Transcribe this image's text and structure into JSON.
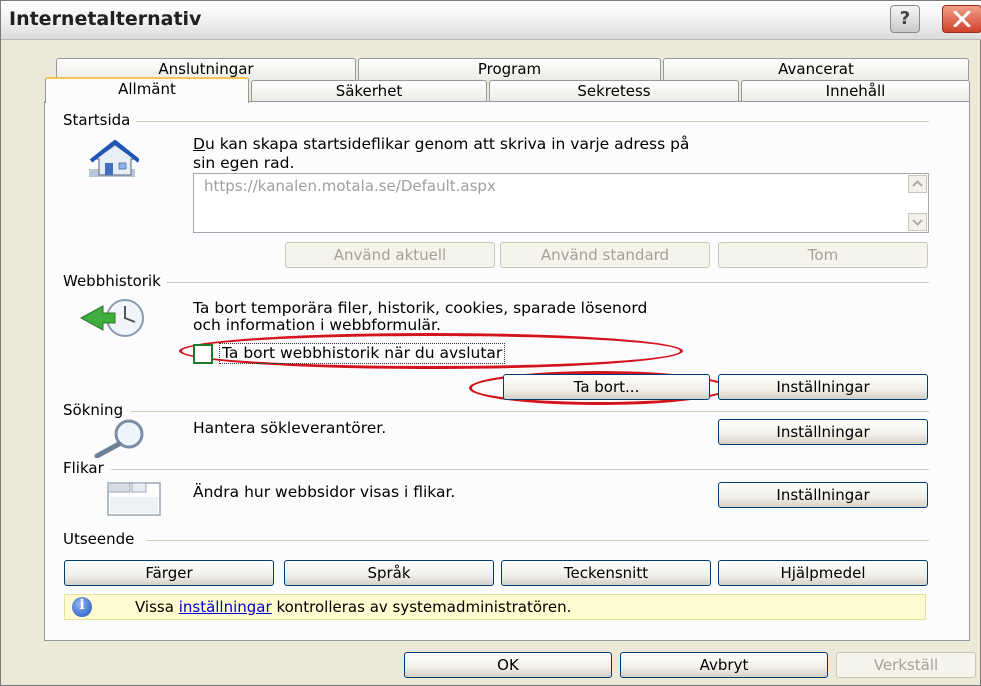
{
  "window": {
    "title": "Internetalternativ"
  },
  "tabs": {
    "back": [
      "Anslutningar",
      "Program",
      "Avancerat"
    ],
    "front": [
      "Allmänt",
      "Säkerhet",
      "Sekretess",
      "Innehåll"
    ]
  },
  "startsida": {
    "group_label": "Startsida",
    "description_line1": "Du kan skapa startsideflikar genom att skriva in varje adress på",
    "description_line2": "sin egen rad.",
    "url_value": "https://kanalen.motala.se/Default.aspx",
    "btn_current": "Använd aktuell",
    "btn_default": "Använd standard",
    "btn_blank": "Tom"
  },
  "webbhistorik": {
    "group_label": "Webbhistorik",
    "description_line1": "Ta bort temporära filer, historik, cookies, sparade lösenord",
    "description_line2": "och information i webbformulär.",
    "checkbox_label": "Ta bort webbhistorik när du avslutar",
    "checkbox_checked": false,
    "btn_delete": "Ta bort...",
    "btn_settings": "Inställningar"
  },
  "sokning": {
    "group_label": "Sökning",
    "description": "Hantera sökleverantörer.",
    "btn_settings": "Inställningar"
  },
  "flikar": {
    "group_label": "Flikar",
    "description": "Ändra hur webbsidor visas i flikar.",
    "btn_settings": "Inställningar"
  },
  "utseende": {
    "group_label": "Utseende",
    "btn_colors": "Färger",
    "btn_languages": "Språk",
    "btn_fonts": "Teckensnitt",
    "btn_accessibility": "Hjälpmedel"
  },
  "info_bar": {
    "prefix": "Vissa",
    "link": "inställningar",
    "suffix": "kontrolleras av systemadministratören."
  },
  "footer": {
    "ok": "OK",
    "cancel": "Avbryt",
    "apply": "Verkställ"
  },
  "colors": {
    "highlight": "#d4141c",
    "checkbox_border": "#1b7a2b"
  }
}
